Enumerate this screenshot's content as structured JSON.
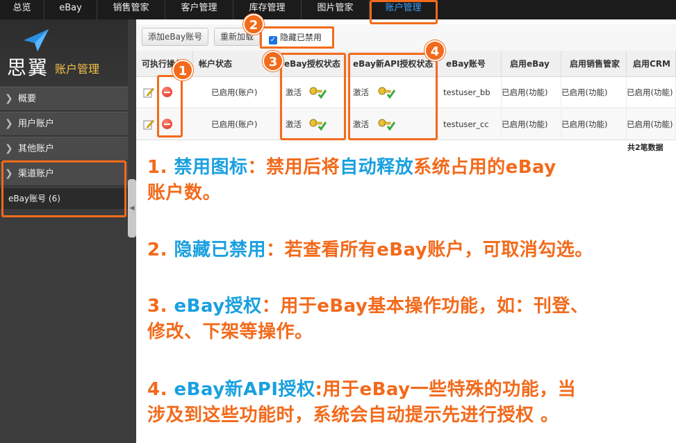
{
  "topnav": {
    "items": [
      {
        "label": "总览"
      },
      {
        "label": "eBay"
      },
      {
        "label": "销售管家"
      },
      {
        "label": "客户管理"
      },
      {
        "label": "库存管理"
      },
      {
        "label": "图片管家"
      },
      {
        "label": "账户管理"
      }
    ],
    "active_index": 6
  },
  "sidebar": {
    "brand": "思翼",
    "module_title": "账户管理",
    "items": [
      {
        "label": "概要"
      },
      {
        "label": "用户账户"
      },
      {
        "label": "其他账户"
      },
      {
        "label": "渠道账户"
      }
    ],
    "sub_item": "eBay账号 (6)"
  },
  "toolbar": {
    "add_label": "添加eBay账号",
    "reload_label": "重新加载",
    "hide_disabled_label": "隐藏已禁用",
    "hide_disabled_checked": true
  },
  "table": {
    "columns": [
      "可执行操作",
      "帐户状态",
      "eBay授权状态",
      "eBay新API授权状态",
      "eBay账号",
      "启用eBay",
      "启用销售管家",
      "启用CRM"
    ],
    "rows": [
      {
        "status": "已启用(账户)",
        "auth": "激活",
        "new_api_auth": "激活",
        "account": "testuser_bb",
        "ebay": "已启用(功能)",
        "sales": "已启用(功能)",
        "crm": "已启用(功能)"
      },
      {
        "status": "已启用(账户)",
        "auth": "激活",
        "new_api_auth": "激活",
        "account": "testuser_cc",
        "ebay": "已启用(功能)",
        "sales": "已启用(功能)",
        "crm": "已启用(功能)"
      }
    ],
    "total": "共2笔数据"
  },
  "badges": [
    "1",
    "2",
    "3",
    "4"
  ],
  "notes": [
    {
      "num": "1. ",
      "term": "禁用图标",
      "sep": "：",
      "line1_a": "禁用后将",
      "line1_b": "自动释放",
      "line1_c": "系统占用的eBay",
      "line2": "账户数。"
    },
    {
      "num": "2. ",
      "term": "隐藏已禁用",
      "sep": "：",
      "text": "若查看所有eBay账户，可取消勾选。"
    },
    {
      "num": "3. ",
      "term": "eBay授权",
      "sep": "：",
      "line1": "用于eBay基本操作功能，如：刊登、",
      "line2": "修改、下架等操作。"
    },
    {
      "num": "4. ",
      "term": "eBay新API授权",
      "sep": ":",
      "line1": "用于eBay一些特殊的功能，当",
      "line2": "涉及到这些功能时，系统会自动提示先进行授权 。"
    }
  ],
  "colors": {
    "accent": "#f26a1b",
    "term_blue": "#1aa0e0",
    "nav_active": "#3aa0ff"
  }
}
